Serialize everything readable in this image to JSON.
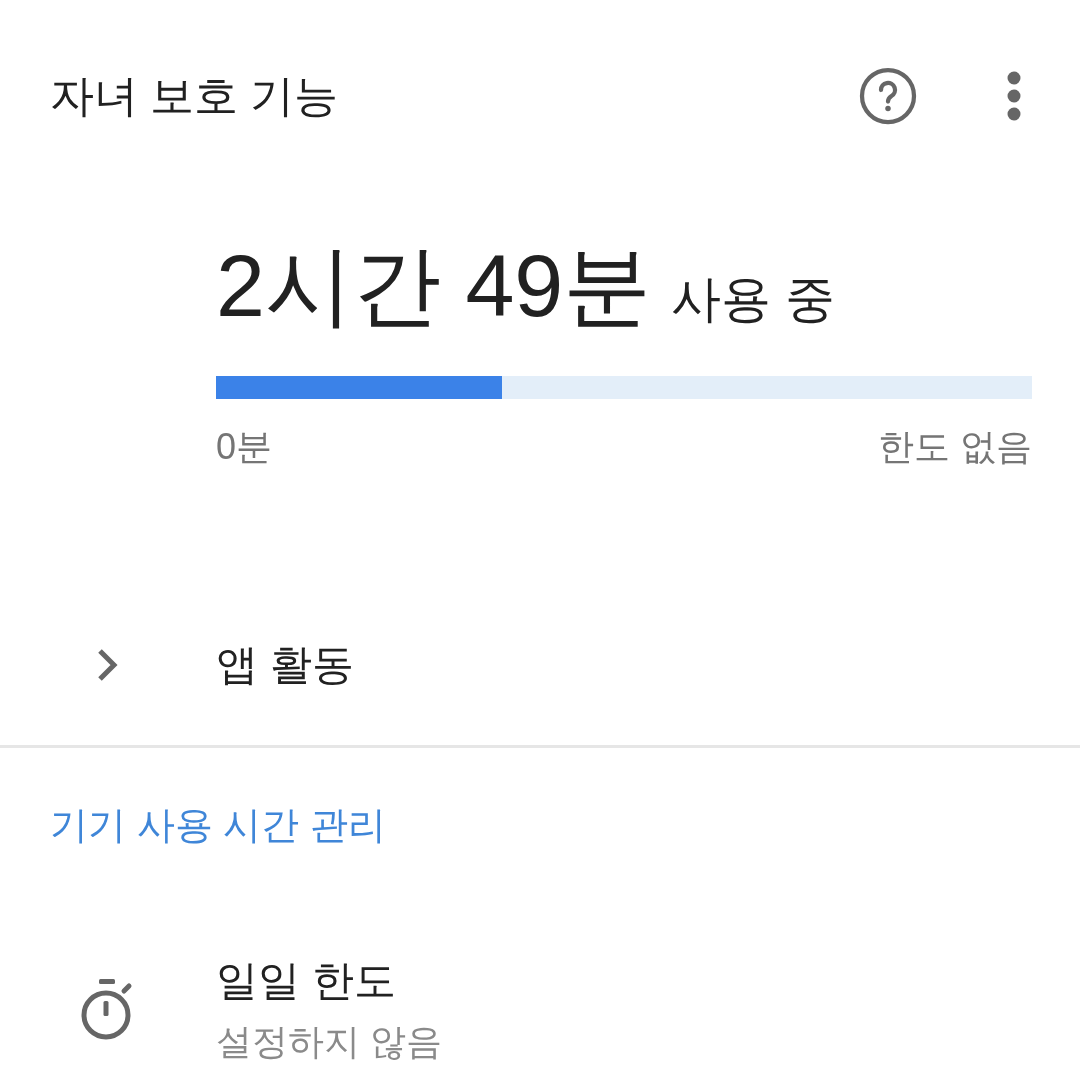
{
  "app_bar": {
    "title": "자녀 보호 기능"
  },
  "usage": {
    "amount": "2시간 49분",
    "suffix": "사용 중",
    "level": 0.35,
    "min_label": "0분",
    "max_label": "한도 없음"
  },
  "app_activity": {
    "label": "앱 활동",
    "expanded": false
  },
  "section": {
    "title": "기기 사용 시간 관리"
  },
  "settings": [
    {
      "title": "일일 한도",
      "subtitle": "설정하지 않음"
    }
  ]
}
